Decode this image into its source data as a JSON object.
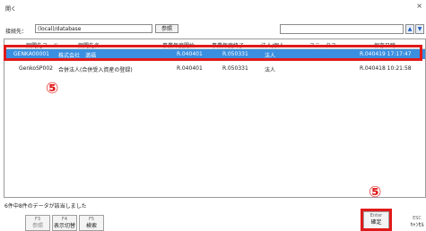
{
  "window": {
    "title": "開く",
    "close_glyph": "×"
  },
  "connection": {
    "label": "接続先：",
    "value": "(local)/database",
    "browse_label": "参照"
  },
  "search": {
    "value": "",
    "up_glyph": "▲",
    "down_glyph": "▼"
  },
  "table": {
    "columns": [
      "顧問先コード",
      "顧問先名",
      "事業年度開始",
      "事業年度終了",
      "法人/個人",
      "ステータス",
      "保存日時"
    ],
    "rows": [
      {
        "code": "GENKA00001",
        "name": "株式会社　満福",
        "start": "R.040401",
        "end": "R.050331",
        "type": "法人",
        "status": "",
        "saved": "R.040419 17:17:47",
        "selected": true
      },
      {
        "code": "GenkoSP002",
        "name": "合併法人(合併受入資産の登録)",
        "start": "R.040401",
        "end": "R.050331",
        "type": "法人",
        "status": "",
        "saved": "R.040418 10:21:58",
        "selected": false
      }
    ]
  },
  "annotations": {
    "marker": "⑤",
    "highlight_color": "#e01a1a"
  },
  "status_text": "6件中8件のデータが該当しました",
  "function_keys": [
    {
      "key": "F3",
      "label": "参照",
      "enabled": false
    },
    {
      "key": "F4",
      "label": "表示切替",
      "enabled": true
    },
    {
      "key": "F5",
      "label": "検索",
      "enabled": true
    },
    {
      "key": "Enter",
      "label": "確定",
      "enabled": true
    },
    {
      "key": "ESC",
      "label": "ｷｬﾝｾﾙ",
      "enabled": true
    }
  ],
  "colors": {
    "selection": "#3a8fe0",
    "accent": "#1b5cb8"
  }
}
